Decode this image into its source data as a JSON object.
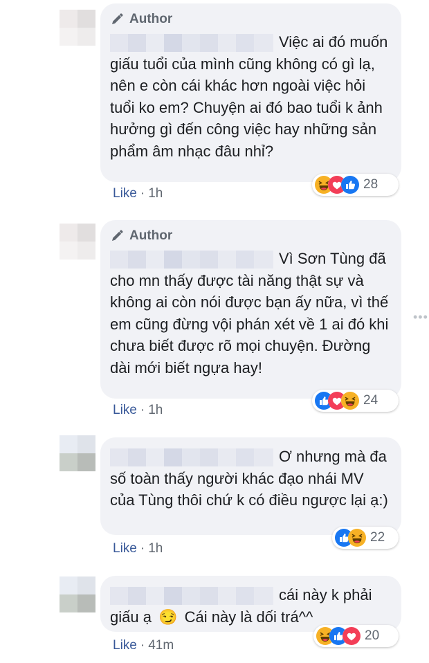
{
  "comments": [
    {
      "author_badge": "Author",
      "text": "Việc ai đó muốn giấu tuổi của mình cũng không có gì lạ, nên e còn cái khác hơn ngoài việc hỏi tuổi ko em? Chuyện ai đó bao tuổi k ảnh hưởng gì đến công việc hay những sản phẩm âm nhạc đâu nhỉ?",
      "reactions": [
        "haha",
        "love",
        "like"
      ],
      "reaction_count": "28",
      "like_label": "Like",
      "separator": "·",
      "time": "1h"
    },
    {
      "author_badge": "Author",
      "text": "Vì Sơn Tùng đã cho mn thấy được tài năng thật sự và không ai còn nói được bạn ấy nữa, vì thế em cũng đừng vội phán xét về 1 ai đó khi chưa biết được rõ mọi chuyện. Đường dài mới biết ngựa hay!",
      "reactions": [
        "like",
        "love",
        "haha"
      ],
      "reaction_count": "24",
      "like_label": "Like",
      "separator": "·",
      "time": "1h"
    },
    {
      "text": "Ơ nhưng mà đa số toàn thấy người khác đạo nhái MV của Tùng thôi chứ k có điều ngược lại ạ:)",
      "reactions": [
        "like",
        "haha"
      ],
      "reaction_count": "22",
      "like_label": "Like",
      "separator": "·",
      "time": "1h"
    },
    {
      "text_part1": "cái này k phải giấu ạ",
      "emoji": "😏",
      "text_part2": "Cái này là dối trá^^",
      "reactions": [
        "haha",
        "like",
        "love"
      ],
      "reaction_count": "20",
      "like_label": "Like",
      "separator": "·",
      "time": "41m"
    }
  ],
  "more_icon": "more-horizontal-icon",
  "colors": {
    "bubble": "#f1f2f6",
    "like_link": "#385898",
    "meta": "#606770",
    "like_blue": "#1877f2",
    "love_red": "#f33e58",
    "haha_yellow": "#f7b125"
  }
}
